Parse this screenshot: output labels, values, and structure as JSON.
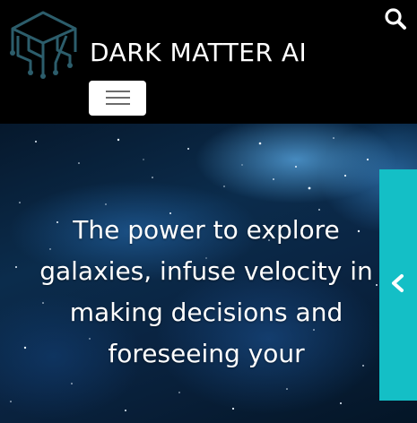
{
  "header": {
    "brand": "DARK MATTER AI",
    "logo_icon": "cube-logo-icon",
    "search_icon": "search-icon",
    "menu_icon": "hamburger-menu-icon"
  },
  "hero": {
    "tagline": "The power to explore galaxies, infuse velocity in making decisions and foreseeing your"
  },
  "side_tab": {
    "icon": "chevron-left-icon",
    "color": "#14bfc6"
  },
  "colors": {
    "header_bg": "#000000",
    "logo": "#2c5d6b",
    "accent": "#14bfc6"
  }
}
